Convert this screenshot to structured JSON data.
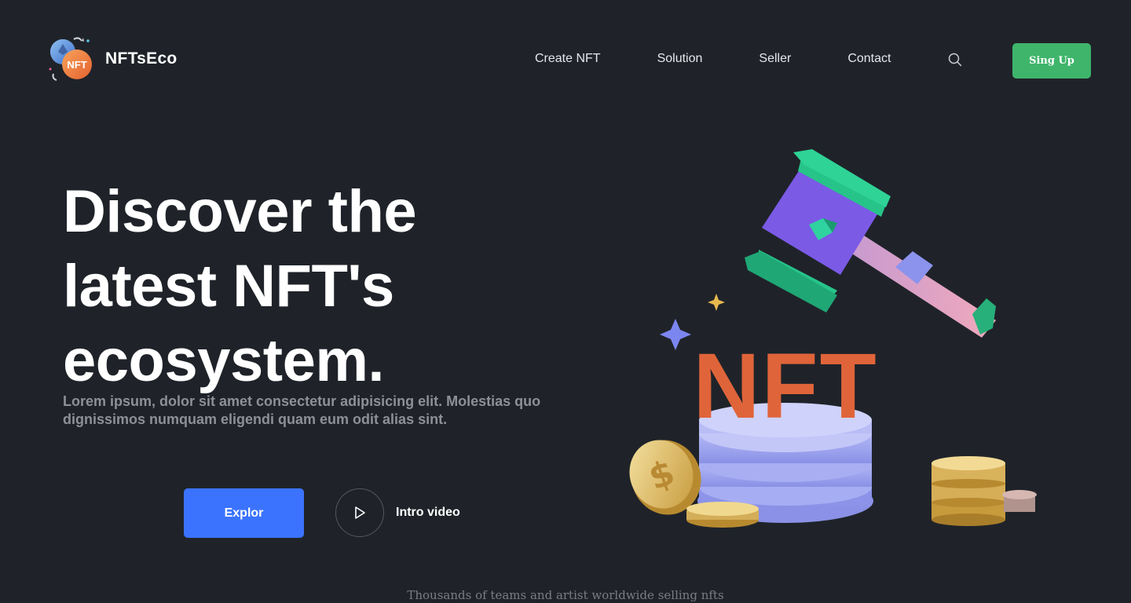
{
  "brand": {
    "name": "NFTsEco",
    "logo_badge": "NFT",
    "logo_icon": "nft-exchange-logo"
  },
  "nav": {
    "items": [
      {
        "label": "Create NFT"
      },
      {
        "label": "Solution"
      },
      {
        "label": "Seller"
      },
      {
        "label": "Contact"
      }
    ],
    "search_icon": "search-icon",
    "signup_label": "Sing Up"
  },
  "hero": {
    "title": "Discover the latest NFT's ecosystem.",
    "description": "Lorem ipsum, dolor sit amet consectetur adipisicing elit. Molestias quo dignissimos numquam eligendi quam eum odit alias sint.",
    "explore_label": "Explor",
    "video_label": "Intro video",
    "illustration_text": "NFT"
  },
  "tagline": "Thousands of teams and artist worldwide selling nfts",
  "colors": {
    "background": "#1f2329",
    "signup": "#3fb56b",
    "explore": "#3b73ff",
    "nft_letters": "#e0643a"
  }
}
